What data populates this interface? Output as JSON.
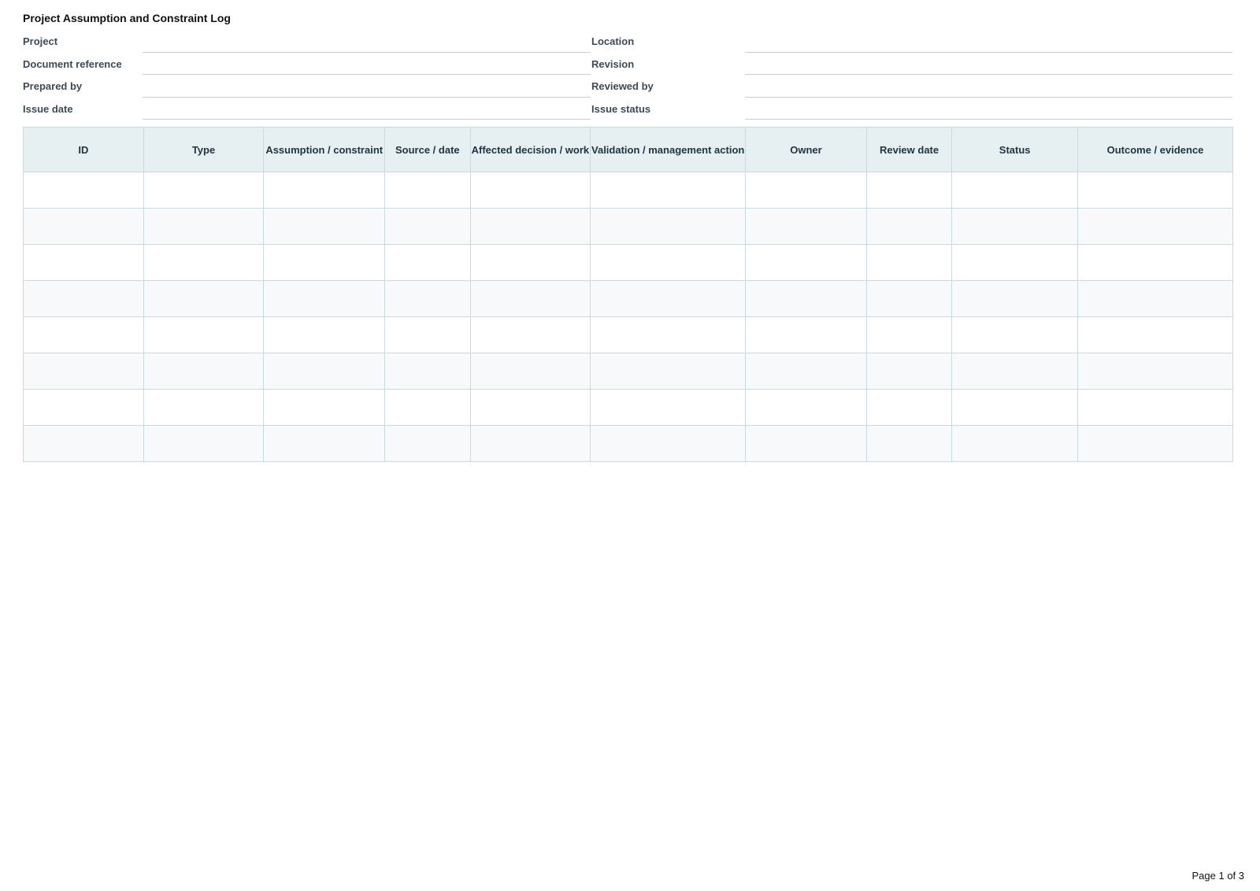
{
  "document": {
    "title": "Project Assumption and Constraint Log"
  },
  "meta": {
    "left_fields": [
      {
        "label": "Project",
        "value": ""
      },
      {
        "label": "Document reference",
        "value": ""
      },
      {
        "label": "Prepared by",
        "value": ""
      },
      {
        "label": "Issue date",
        "value": ""
      }
    ],
    "right_fields": [
      {
        "label": "Location",
        "value": ""
      },
      {
        "label": "Revision",
        "value": ""
      },
      {
        "label": "Reviewed by",
        "value": ""
      },
      {
        "label": "Issue status",
        "value": ""
      }
    ]
  },
  "table": {
    "columns": [
      "ID",
      "Type",
      "Assumption / constraint",
      "Source / date",
      "Affected decision / work",
      "Validation / management action",
      "Owner",
      "Review date",
      "Status",
      "Outcome / evidence"
    ],
    "rows": [
      [
        "",
        "",
        "",
        "",
        "",
        "",
        "",
        "",
        "",
        ""
      ],
      [
        "",
        "",
        "",
        "",
        "",
        "",
        "",
        "",
        "",
        ""
      ],
      [
        "",
        "",
        "",
        "",
        "",
        "",
        "",
        "",
        "",
        ""
      ],
      [
        "",
        "",
        "",
        "",
        "",
        "",
        "",
        "",
        "",
        ""
      ],
      [
        "",
        "",
        "",
        "",
        "",
        "",
        "",
        "",
        "",
        ""
      ],
      [
        "",
        "",
        "",
        "",
        "",
        "",
        "",
        "",
        "",
        ""
      ],
      [
        "",
        "",
        "",
        "",
        "",
        "",
        "",
        "",
        "",
        ""
      ],
      [
        "",
        "",
        "",
        "",
        "",
        "",
        "",
        "",
        "",
        ""
      ]
    ]
  },
  "footer": {
    "page_label": "Page 1 of 3"
  },
  "colors": {
    "header_fill": "#e6eff1",
    "grid_line": "#cbdadf",
    "alt_row_fill": "#f7f9fa",
    "label_text": "#3d4a56"
  }
}
